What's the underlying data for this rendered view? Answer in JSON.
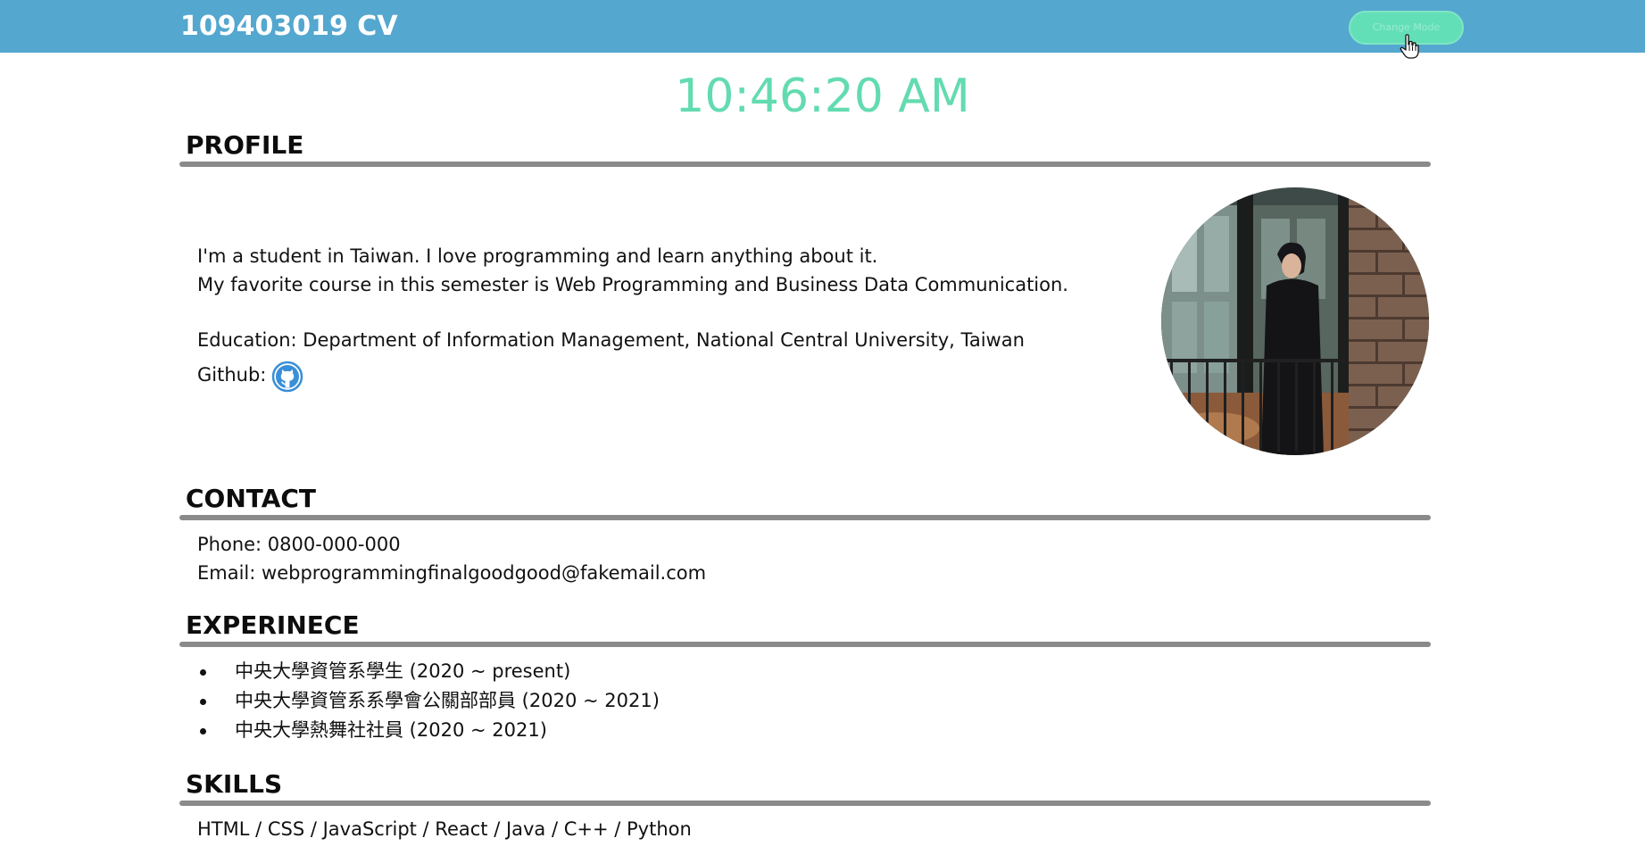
{
  "header": {
    "title": "109403019 CV",
    "mode_button": "Change Mode"
  },
  "clock": "10:46:20 AM",
  "profile": {
    "heading": "PROFILE",
    "line1": "I'm a student in Taiwan. I love programming and learn anything about it.",
    "line2": "My favorite course in this semester is Web Programming and Business Data Communication.",
    "education": "Education: Department of Information Management, National Central University, Taiwan",
    "github_label": "Github:",
    "github_icon": "github-icon"
  },
  "contact": {
    "heading": "CONTACT",
    "phone": "Phone: 0800-000-000",
    "email": "Email: webprogrammingfinalgoodgood@fakemail.com"
  },
  "experience": {
    "heading": "EXPERINECE",
    "items": [
      "中央大學資管系學生 (2020 ~ present)",
      "中央大學資管系系學會公關部部員 (2020 ~ 2021)",
      "中央大學熱舞社社員 (2020 ~ 2021)"
    ]
  },
  "skills": {
    "heading": "SKILLS",
    "list": "HTML / CSS / JavaScript / React / Java / C++ / Python"
  },
  "colors": {
    "header_bg": "#54a7cf",
    "clock": "#63dbb0",
    "button": "#63dfb8",
    "rule": "#8a8a8a",
    "github_icon": "#3a8fd8"
  }
}
